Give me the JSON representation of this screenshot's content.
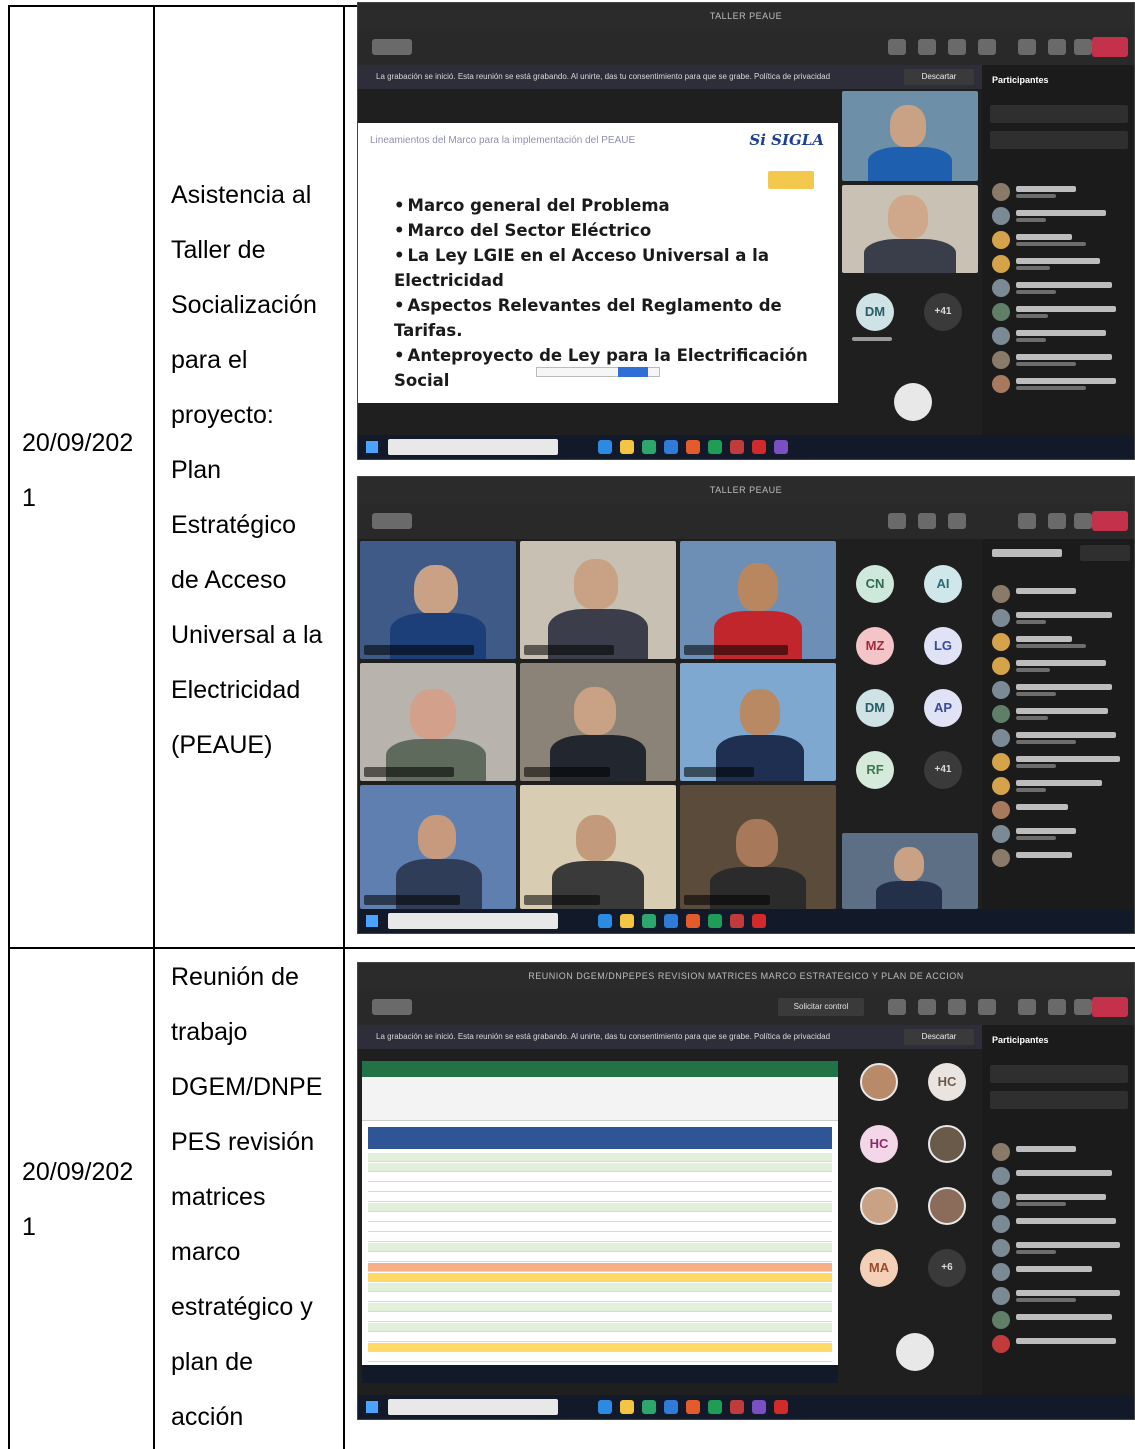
{
  "rows": [
    {
      "date": [
        "20/09/202",
        "1"
      ],
      "activity": [
        "Asistencia al",
        "Taller de",
        "Socialización",
        "para el",
        "proyecto:",
        "Plan",
        "Estratégico",
        "de Acceso",
        "Universal a la",
        "Electricidad",
        "(PEAUE)"
      ],
      "screenshots": [
        {
          "window_title": "TALLER PEAUE",
          "recording_banner": "La grabación se inició. Esta reunión se está grabando. Al unirte, das tu consentimiento para que se grabe. Política de privacidad",
          "discard_label": "Descartar",
          "panel_title": "Participantes",
          "slide": {
            "title": "Lineamientos del Marco para la implementación del PEAUE",
            "logo_text": "SIGLA",
            "bullets": [
              "Marco general del Problema",
              "Marco del Sector Eléctrico",
              "La Ley LGIE en el Acceso Universal a la Electricidad",
              "Aspectos Relevantes del Reglamento de Tarifas.",
              "Anteproyecto de Ley para la Electrificación Social"
            ]
          },
          "avatars": [
            "DM",
            "+41"
          ]
        },
        {
          "window_title": "TALLER PEAUE",
          "avatars": [
            "CN",
            "AI",
            "MZ",
            "LG",
            "DM",
            "AP",
            "RF",
            "+41"
          ]
        }
      ]
    },
    {
      "date": [
        "20/09/202",
        "1"
      ],
      "activity": [
        "Reunión de",
        "trabajo",
        "DGEM/DNPE",
        "PES revisión",
        "matrices",
        "marco",
        "estratégico y",
        "plan de",
        "acción"
      ],
      "screenshots": [
        {
          "window_title": "REUNION DGEM/DNPEPES REVISION MATRICES MARCO ESTRATEGICO Y PLAN DE ACCION",
          "control_label": "Solicitar control",
          "recording_banner": "La grabación se inició. Esta reunión se está grabando. Al unirte, das tu consentimiento para que se grabe. Política de privacidad",
          "discard_label": "Descartar",
          "panel_title": "Participantes",
          "avatars": [
            "HC",
            "HC",
            "MA",
            "+6"
          ]
        }
      ]
    }
  ]
}
